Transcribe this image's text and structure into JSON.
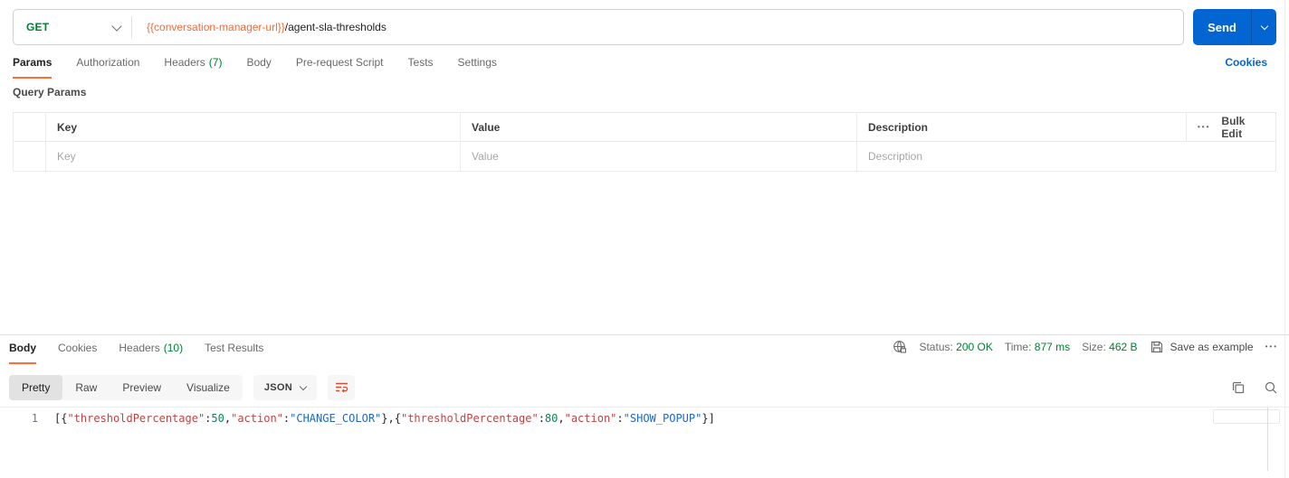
{
  "request": {
    "method": "GET",
    "url_variable": "{{conversation-manager-url}}",
    "url_path": "/agent-sla-thresholds",
    "send_label": "Send"
  },
  "request_tabs": {
    "items": [
      {
        "label": "Params",
        "active": true
      },
      {
        "label": "Authorization",
        "active": false
      },
      {
        "label": "Headers",
        "count": "(7)",
        "active": false
      },
      {
        "label": "Body",
        "active": false
      },
      {
        "label": "Pre-request Script",
        "active": false
      },
      {
        "label": "Tests",
        "active": false
      },
      {
        "label": "Settings",
        "active": false
      }
    ],
    "cookies_link": "Cookies"
  },
  "query_params": {
    "title": "Query Params",
    "columns": [
      "Key",
      "Value",
      "Description"
    ],
    "bulk_edit_label": "Bulk Edit",
    "placeholders": {
      "key": "Key",
      "value": "Value",
      "description": "Description"
    }
  },
  "response": {
    "tabs": [
      {
        "label": "Body",
        "active": true
      },
      {
        "label": "Cookies",
        "active": false
      },
      {
        "label": "Headers",
        "count": "(10)",
        "active": false
      },
      {
        "label": "Test Results",
        "active": false
      }
    ],
    "meta": {
      "status_label": "Status:",
      "status_value": "200 OK",
      "time_label": "Time:",
      "time_value": "877 ms",
      "size_label": "Size:",
      "size_value": "462 B",
      "save_as_example_label": "Save as example"
    },
    "view_tabs": [
      {
        "label": "Pretty",
        "active": true
      },
      {
        "label": "Raw",
        "active": false
      },
      {
        "label": "Preview",
        "active": false
      },
      {
        "label": "Visualize",
        "active": false
      }
    ],
    "language": "JSON",
    "body": {
      "line_number": "1",
      "raw": "[{\"thresholdPercentage\":50,\"action\":\"CHANGE_COLOR\"},{\"thresholdPercentage\":80,\"action\":\"SHOW_POPUP\"}]",
      "tokens": [
        {
          "type": "punct",
          "text": "[{"
        },
        {
          "type": "key",
          "text": "\"thresholdPercentage\""
        },
        {
          "type": "punct",
          "text": ":"
        },
        {
          "type": "number",
          "text": "50"
        },
        {
          "type": "punct",
          "text": ","
        },
        {
          "type": "key",
          "text": "\"action\""
        },
        {
          "type": "punct",
          "text": ":"
        },
        {
          "type": "string",
          "text": "\"CHANGE_COLOR\""
        },
        {
          "type": "punct",
          "text": "},{"
        },
        {
          "type": "key",
          "text": "\"thresholdPercentage\""
        },
        {
          "type": "punct",
          "text": ":"
        },
        {
          "type": "number",
          "text": "80"
        },
        {
          "type": "punct",
          "text": ","
        },
        {
          "type": "key",
          "text": "\"action\""
        },
        {
          "type": "punct",
          "text": ":"
        },
        {
          "type": "string",
          "text": "\"SHOW_POPUP\""
        },
        {
          "type": "punct",
          "text": "}]"
        }
      ]
    }
  },
  "icons": {
    "ellipsis": "•••"
  },
  "colors": {
    "accent_orange": "#ff6c37",
    "url_variable_orange": "#f26b3a",
    "method_get_green": "#007f31",
    "count_green": "#007f31",
    "status_green": "#007f31",
    "send_button_blue": "#0265d2",
    "link_blue": "#0265d2",
    "syntax_key": "#bf4342",
    "syntax_string": "#2068c0",
    "syntax_number": "#128051",
    "syntax_punct": "#24292e"
  }
}
